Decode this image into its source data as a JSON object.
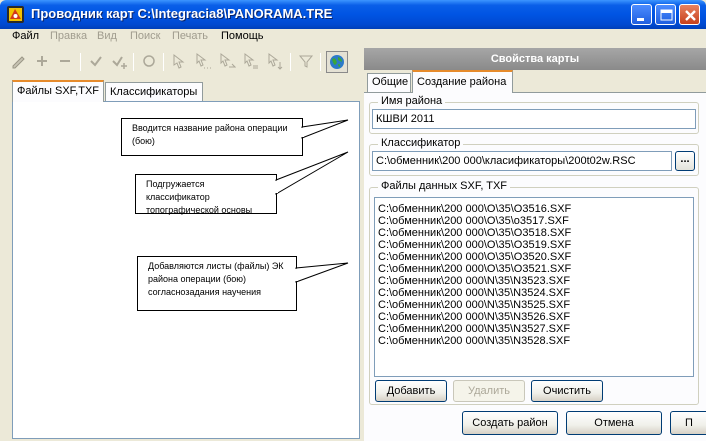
{
  "window": {
    "title": "Проводник карт C:\\Integracia8\\PANORAMA.TRE"
  },
  "menu": [
    {
      "label": "Файл",
      "enabled": true
    },
    {
      "label": "Правка",
      "enabled": false
    },
    {
      "label": "Вид",
      "enabled": false
    },
    {
      "label": "Поиск",
      "enabled": false
    },
    {
      "label": "Печать",
      "enabled": false
    },
    {
      "label": "Помощь",
      "enabled": true
    }
  ],
  "toolbar": {
    "icons": [
      "pencil-icon",
      "add-icon",
      "remove-icon",
      "check-icon",
      "check-plus-icon",
      "refresh-icon",
      "pointer-icon",
      "pointer-dots-icon",
      "pointer-arrow-icon",
      "pointer-swap-icon",
      "pointer-down-icon",
      "filter-icon",
      "globe-icon"
    ]
  },
  "left": {
    "tabs": [
      "Файлы SXF,TXF",
      "Классификаторы"
    ],
    "active_tab": 0,
    "callouts": [
      "Вводится название района операции (бою)",
      "Подгружается классификатор топографической основы",
      "Добавляются листы (файлы) ЭК района операции (бою) согласнозадания научения"
    ]
  },
  "right": {
    "header": "Свойства карты",
    "tabs": [
      "Общие",
      "Создание района"
    ],
    "active_tab": 1,
    "region_name": {
      "label": "Имя района",
      "value": "КШВИ 2011"
    },
    "classifier": {
      "label": "Классификатор",
      "value": "C:\\обменник\\200 000\\класификаторы\\200t02w.RSC",
      "browse_label": "..."
    },
    "data_files": {
      "label": "Файлы данных SXF, TXF",
      "items": [
        "C:\\обменник\\200 000\\O\\35\\O3516.SXF",
        "C:\\обменник\\200 000\\O\\35\\o3517.SXF",
        "C:\\обменник\\200 000\\O\\35\\O3518.SXF",
        "C:\\обменник\\200 000\\O\\35\\O3519.SXF",
        "C:\\обменник\\200 000\\O\\35\\O3520.SXF",
        "C:\\обменник\\200 000\\O\\35\\O3521.SXF",
        "C:\\обменник\\200 000\\N\\35\\N3523.SXF",
        "C:\\обменник\\200 000\\N\\35\\N3524.SXF",
        "C:\\обменник\\200 000\\N\\35\\N3525.SXF",
        "C:\\обменник\\200 000\\N\\35\\N3526.SXF",
        "C:\\обменник\\200 000\\N\\35\\N3527.SXF",
        "C:\\обменник\\200 000\\N\\35\\N3528.SXF"
      ],
      "add_label": "Добавить",
      "delete_label": "Удалить",
      "clear_label": "Очистить"
    },
    "create_label": "Создать район",
    "cancel_label": "Отмена",
    "cut_label": "П"
  }
}
